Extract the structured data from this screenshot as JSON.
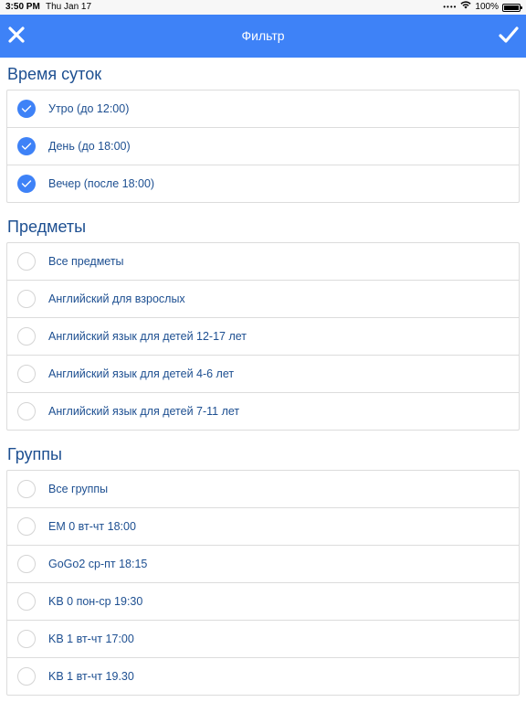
{
  "status_bar": {
    "time": "3:50 PM",
    "date": "Thu Jan 17",
    "battery": "100%"
  },
  "nav": {
    "title": "Фильтр",
    "close_icon": "close-icon",
    "confirm_icon": "checkmark-icon"
  },
  "colors": {
    "accent": "#3e82f7",
    "section_text": "#1d4f91"
  },
  "sections": [
    {
      "title": "Время суток",
      "items": [
        {
          "label": "Утро (до 12:00)",
          "checked": true
        },
        {
          "label": "День (до 18:00)",
          "checked": true
        },
        {
          "label": "Вечер (после 18:00)",
          "checked": true
        }
      ]
    },
    {
      "title": "Предметы",
      "items": [
        {
          "label": "Все предметы",
          "checked": false
        },
        {
          "label": "Английский для взрослых",
          "checked": false
        },
        {
          "label": "Английский язык для детей 12-17 лет",
          "checked": false
        },
        {
          "label": "Английский язык для детей 4-6 лет",
          "checked": false
        },
        {
          "label": "Английский язык для детей 7-11 лет",
          "checked": false
        }
      ]
    },
    {
      "title": "Группы",
      "items": [
        {
          "label": "Все группы",
          "checked": false
        },
        {
          "label": "EM 0 вт-чт 18:00",
          "checked": false
        },
        {
          "label": "GoGo2 ср-пт 18:15",
          "checked": false
        },
        {
          "label": "KB 0 пон-ср 19:30",
          "checked": false
        },
        {
          "label": "KB 1 вт-чт 17:00",
          "checked": false
        },
        {
          "label": "KB 1 вт-чт 19.30",
          "checked": false
        }
      ]
    }
  ]
}
